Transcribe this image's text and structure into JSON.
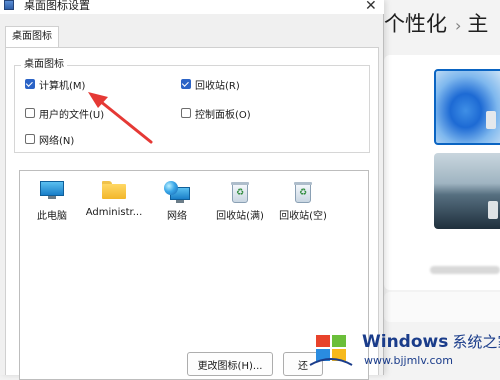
{
  "dialog": {
    "title": "桌面图标设置",
    "tab": "桌面图标",
    "group_label": "桌面图标",
    "checkboxes": [
      {
        "label": "计算机(M)",
        "checked": true
      },
      {
        "label": "回收站(R)",
        "checked": true
      },
      {
        "label": "用户的文件(U)",
        "checked": false
      },
      {
        "label": "控制面板(O)",
        "checked": false
      },
      {
        "label": "网络(N)",
        "checked": false
      }
    ],
    "icons": [
      {
        "label": "此电脑",
        "icon": "computer-icon"
      },
      {
        "label": "Administr...",
        "icon": "folder-icon"
      },
      {
        "label": "网络",
        "icon": "network-icon"
      },
      {
        "label": "回收站(满)",
        "icon": "recycle-bin-full-icon"
      },
      {
        "label": "回收站(空)",
        "icon": "recycle-bin-empty-icon"
      }
    ],
    "buttons": {
      "change_icon": "更改图标(H)...",
      "restore": "还"
    }
  },
  "background": {
    "title": "个性化",
    "separator": "›",
    "next_crumb": "主"
  },
  "watermark": {
    "brand": "Windows",
    "brand_cn": "系统之家",
    "url": "www.bjjmlv.com"
  },
  "colors": {
    "accent": "#2b63c6",
    "arrow": "#e53935",
    "watermark": "#1a3c8a"
  }
}
